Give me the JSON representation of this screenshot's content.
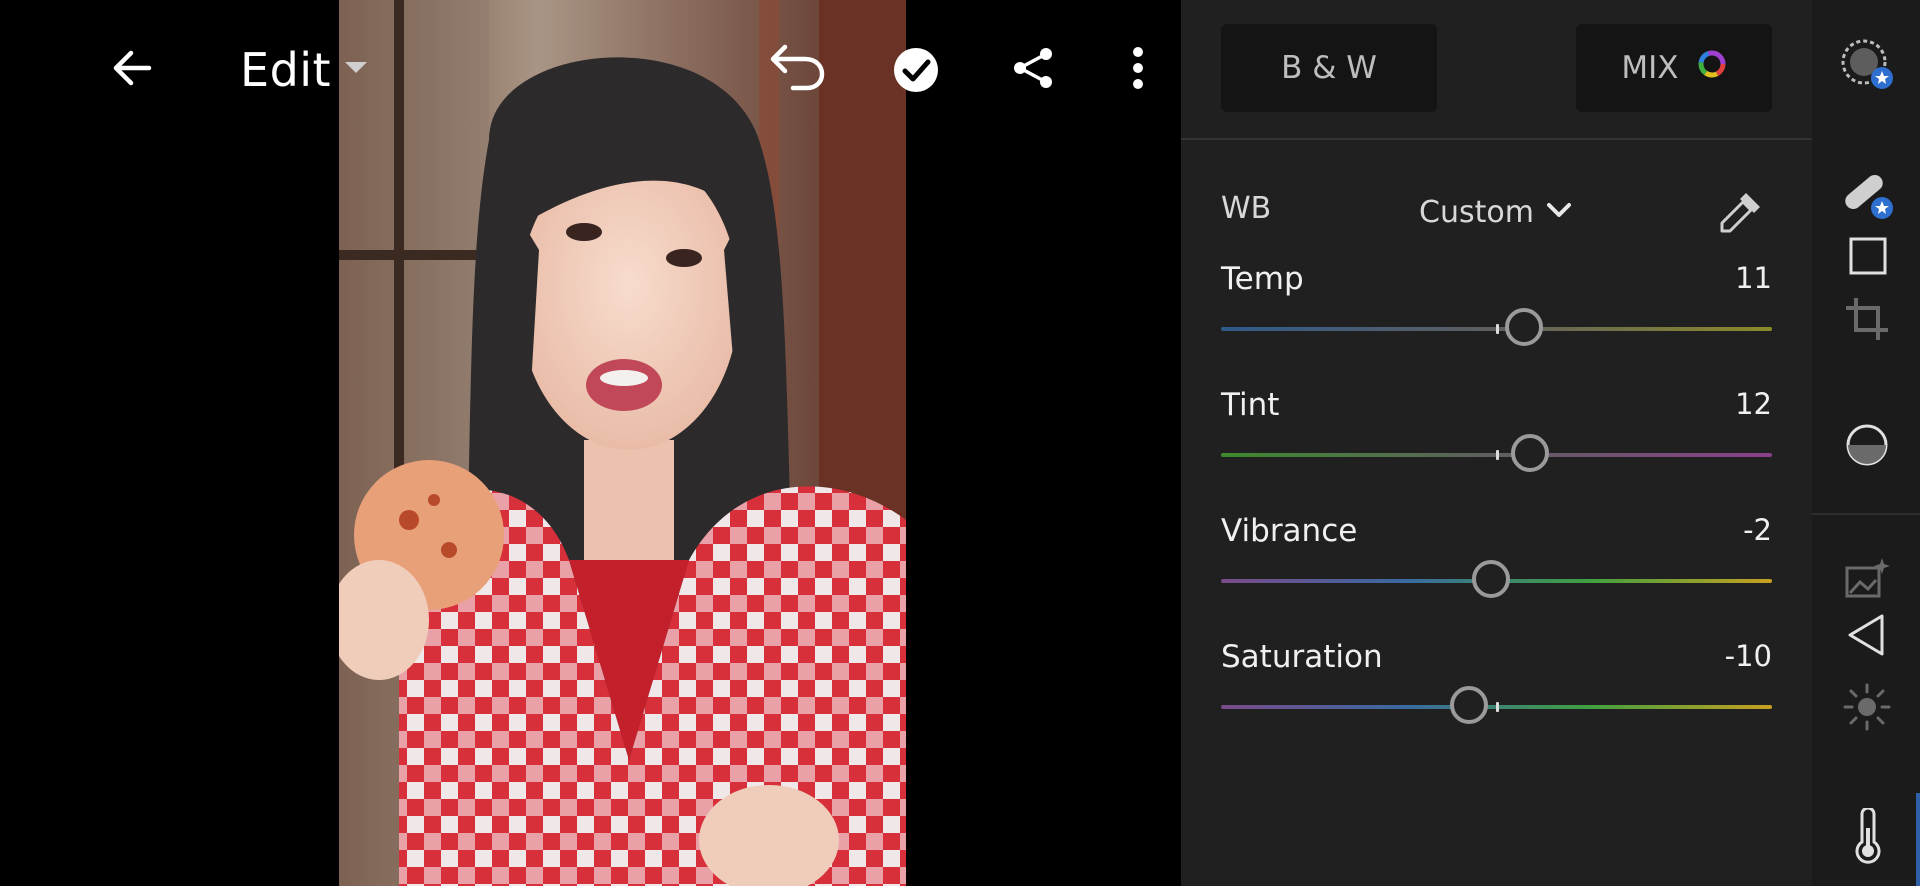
{
  "header": {
    "back_icon": "back-arrow-icon",
    "edit_label": "Edit",
    "edit_dropdown_icon": "caret-down-icon",
    "undo_icon": "undo-icon",
    "done_icon": "checkmark-circle-icon",
    "share_icon": "share-icon",
    "more_icon": "more-vertical-icon"
  },
  "panel": {
    "bw_label": "B & W",
    "mix_label": "MIX",
    "mix_icon": "color-wheel-icon",
    "wb": {
      "label": "WB",
      "value": "Custom",
      "dropdown_icon": "chevron-down-icon",
      "eyedropper_icon": "eyedropper-icon"
    },
    "sliders": [
      {
        "name": "Temp",
        "value": "11",
        "level": 0.55,
        "colors": [
          "#2f5a8a",
          "#5f5f5f",
          "#8a8a2a"
        ]
      },
      {
        "name": "Tint",
        "value": "12",
        "level": 0.56,
        "colors": [
          "#3d8a2e",
          "#5f5f5f",
          "#8a3f8a"
        ]
      },
      {
        "name": "Vibrance",
        "value": "-2",
        "level": 0.49,
        "colors": [
          "#7a4a8a",
          "#3a6aa0",
          "#3fa040",
          "#c8a020"
        ]
      },
      {
        "name": "Saturation",
        "value": "-10",
        "level": 0.45,
        "colors": [
          "#7a4a8a",
          "#3a6aa0",
          "#3fa040",
          "#c8a020"
        ]
      }
    ]
  },
  "rail": {
    "icons": [
      "presets-icon",
      "healing-icon",
      "crop-square-icon",
      "crop-rotate-icon",
      "masking-icon",
      "enhance-image-icon",
      "optics-triangle-icon",
      "light-sun-icon",
      "temperature-thermometer-icon"
    ]
  },
  "colors": {
    "panel_bg": "#202020",
    "rail_bg": "#1b1b1b",
    "button_bg": "#141414",
    "accent_blue": "#2f6fd0"
  }
}
